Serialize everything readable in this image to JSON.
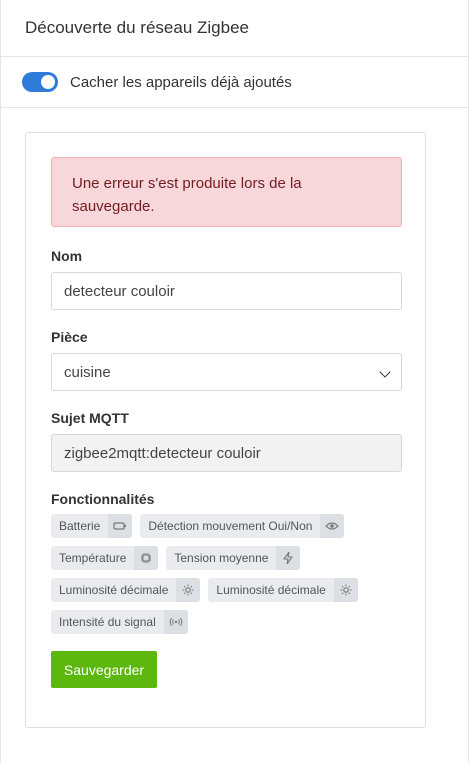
{
  "header": {
    "title": "Découverte du réseau Zigbee"
  },
  "toggle": {
    "label": "Cacher les appareils déjà ajoutés",
    "checked": true,
    "color": "#2f7bd9"
  },
  "form": {
    "alert": "Une erreur s'est produite lors de la sauvegarde.",
    "name_label": "Nom",
    "name_value": "detecteur couloir",
    "room_label": "Pièce",
    "room_value": "cuisine",
    "mqtt_label": "Sujet MQTT",
    "mqtt_value": "zigbee2mqtt:detecteur couloir",
    "features_label": "Fonctionnalités",
    "features": [
      {
        "label": "Batterie",
        "icon": "battery-icon"
      },
      {
        "label": "Détection mouvement Oui/Non",
        "icon": "eye-icon"
      },
      {
        "label": "Température",
        "icon": "thermometer-chip-icon"
      },
      {
        "label": "Tension moyenne",
        "icon": "lightning-icon"
      },
      {
        "label": "Luminosité décimale",
        "icon": "sun-icon"
      },
      {
        "label": "Luminosité décimale",
        "icon": "sun-icon"
      },
      {
        "label": "Intensité du signal",
        "icon": "signal-icon"
      }
    ],
    "save_label": "Sauvegarder",
    "save_color": "#5cb80f"
  }
}
